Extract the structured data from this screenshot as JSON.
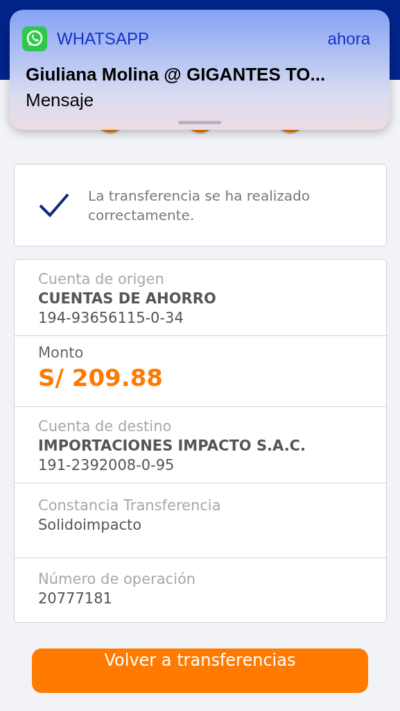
{
  "notification": {
    "app": "WHATSAPP",
    "time": "ahora",
    "title": "Giuliana Molina @ GIGANTES TO...",
    "body": "Mensaje"
  },
  "success": {
    "message": "La transferencia se ha realizado correctamente."
  },
  "details": [
    {
      "kind": "account",
      "label": "Cuenta de origen",
      "name": "CUENTAS DE AHORRO",
      "number": "194-93656115-0-34"
    },
    {
      "kind": "amount",
      "label": "Monto",
      "value": "S/ 209.88"
    },
    {
      "kind": "account",
      "label": "Cuenta de destino",
      "name": "IMPORTACIONES IMPACTO S.A.C.",
      "number": "191-2392008-0-95"
    },
    {
      "kind": "text",
      "label": "Constancia Transferencia",
      "value": "Solidoimpacto"
    },
    {
      "kind": "text",
      "label": "Número de operación",
      "value": "20777181"
    }
  ],
  "button": "Volver a transferencias"
}
